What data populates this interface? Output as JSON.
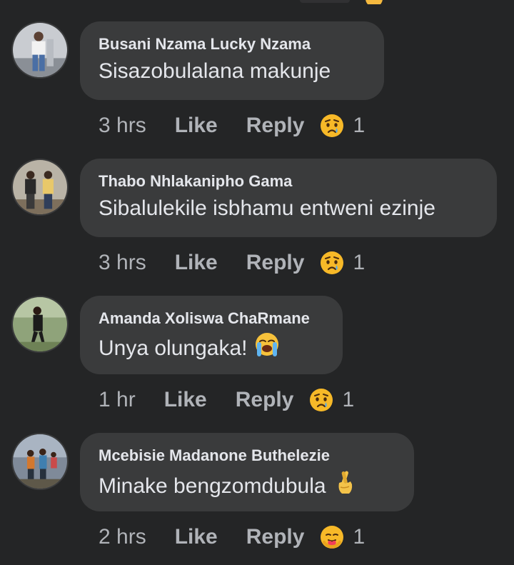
{
  "comments": [
    {
      "author": "Busani Nzama Lucky Nzama",
      "text": "Sisazobulalana makunje",
      "time": "3 hrs",
      "like_label": "Like",
      "reply_label": "Reply",
      "reaction_icon": "sad-reaction-icon",
      "reaction_count": "1"
    },
    {
      "author": "Thabo Nhlakanipho Gama",
      "text": "Sibalulekile isbhamu entweni ezinje",
      "time": "3 hrs",
      "like_label": "Like",
      "reply_label": "Reply",
      "reaction_icon": "sad-reaction-icon",
      "reaction_count": "1"
    },
    {
      "author": "Amanda Xoliswa ChaRmane",
      "text": "Unya olungaka!",
      "text_emoji": "loudly-crying-face-icon",
      "time": "1 hr",
      "like_label": "Like",
      "reply_label": "Reply",
      "reaction_icon": "sad-reaction-icon",
      "reaction_count": "1"
    },
    {
      "author": "Mcebisie Madanone Buthelezie",
      "text": "Minake bengzomdubula",
      "text_emoji": "crossed-fingers-icon",
      "time": "2 hrs",
      "like_label": "Like",
      "reply_label": "Reply",
      "reaction_icon": "care-reaction-icon",
      "reaction_count": "1"
    }
  ],
  "colors": {
    "background": "#242526",
    "bubble": "#3a3b3c",
    "primary_text": "#e4e6eb",
    "secondary_text": "#b0b3b8"
  }
}
